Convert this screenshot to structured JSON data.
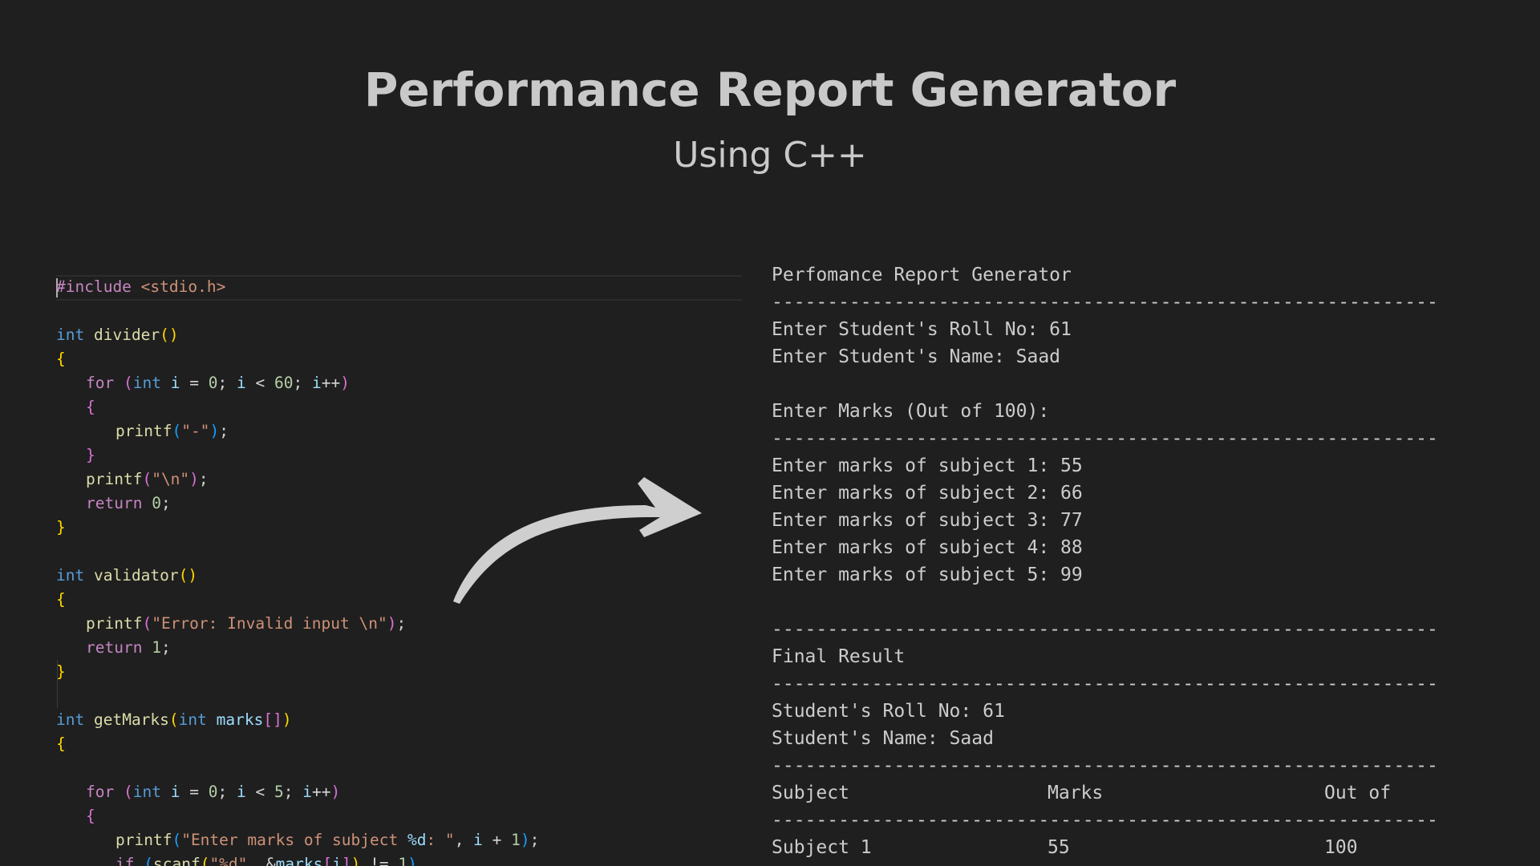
{
  "header": {
    "title": "Performance Report Generator",
    "subtitle": "Using C++"
  },
  "code": {
    "include": "#include",
    "header_file": "<stdio.h>",
    "fn_divider": "divider",
    "fn_validator": "validator",
    "fn_getMarks": "getMarks",
    "fn_printf": "printf",
    "fn_scanf": "scanf",
    "kw_int": "int",
    "kw_for": "for",
    "kw_return": "return",
    "kw_if": "if",
    "str_dash": "\"-\"",
    "str_newline": "\"\\n\"",
    "str_error": "\"Error: Invalid input \\n\"",
    "str_enter_marks_a": "\"Enter marks of subject ",
    "str_fmt_d": "%d",
    "str_enter_marks_b": ": \"",
    "str_scan_fmt": "\"%d\"",
    "var_i": "i",
    "var_marks": "marks",
    "num_0": "0",
    "num_60": "60",
    "num_1": "1",
    "num_5": "5"
  },
  "terminal": {
    "heading": "Perfomance Report Generator",
    "separator": "------------------------------------------------------------",
    "roll_prompt": "Enter Student's Roll No: 61",
    "name_prompt": "Enter Student's Name: Saad",
    "marks_heading": "Enter Marks (Out of 100):",
    "marks_inputs": [
      "Enter marks of subject 1: 55",
      "Enter marks of subject 2: 66",
      "Enter marks of subject 3: 77",
      "Enter marks of subject 4: 88",
      "Enter marks of subject 5: 99"
    ],
    "final_heading": "Final Result",
    "roll_result": "Student's Roll No: 61",
    "name_result": "Student's Name: Saad",
    "table_headers": [
      "Subject",
      "Marks",
      "Out of"
    ],
    "table_rows": [
      [
        "Subject 1",
        "55",
        "100"
      ]
    ]
  },
  "arrow": {
    "color": "#cfcfcf",
    "icon": "curved-arrow-right-icon"
  }
}
